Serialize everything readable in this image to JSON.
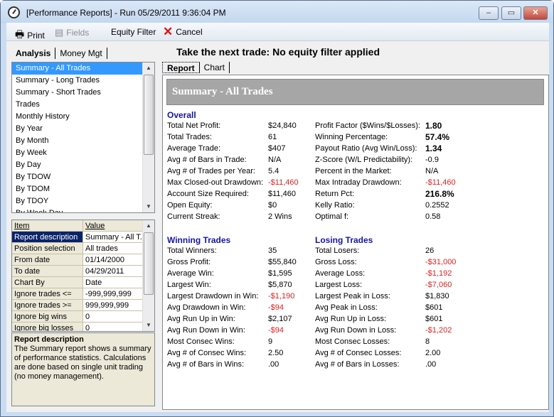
{
  "window": {
    "title": "[Performance Reports]  -  Run 05/29/2011 9:36:04 PM",
    "minimize": "–",
    "maximize": "▭",
    "close": "✕"
  },
  "toolbar": {
    "print": "Print",
    "fields": "Fields",
    "equity_filter": "Equity Filter",
    "cancel": "Cancel"
  },
  "left_tabs": [
    {
      "label": "Analysis"
    },
    {
      "label": "Money Mgt"
    }
  ],
  "reports": [
    "Summary - All Trades",
    "Summary - Long Trades",
    "Summary - Short Trades",
    "Trades",
    "Monthly History",
    "By Year",
    "By Month",
    "By Week",
    "By Day",
    "By TDOW",
    "By TDOM",
    "By TDOY",
    "By Week Day"
  ],
  "properties": {
    "headers": [
      "Item",
      "Value"
    ],
    "rows": [
      [
        "Report description",
        "Summary - All T..."
      ],
      [
        "Position selection",
        "All trades"
      ],
      [
        "From date",
        "01/14/2000"
      ],
      [
        "To date",
        "04/29/2011"
      ],
      [
        "Chart By",
        "Date"
      ],
      [
        "Ignore trades <=",
        "-999,999,999"
      ],
      [
        "Ignore trades >=",
        "999,999,999"
      ],
      [
        "Ignore big wins",
        "0"
      ],
      [
        "Ignore big losses",
        "0"
      ]
    ]
  },
  "description": {
    "title": "Report description",
    "text": "The Summary report shows a summary of performance statistics.  Calculations are done based on single unit trading (no money management)."
  },
  "headline": "Take the next trade: No equity filter applied",
  "right_tabs": [
    {
      "label": "Report"
    },
    {
      "label": "Chart"
    }
  ],
  "report": {
    "title": "Summary - All Trades",
    "overall_title": "Overall",
    "overall_left": [
      [
        "Total Net Profit:",
        "$24,840"
      ],
      [
        "Total Trades:",
        "61"
      ],
      [
        "Average Trade:",
        "$407"
      ],
      [
        "Avg # of Bars in Trade:",
        "N/A"
      ],
      [
        "Avg # of Trades per Year:",
        "5.4"
      ],
      [
        "Max Closed-out Drawdown:",
        "-$11,460"
      ],
      [
        "Account Size Required:",
        "$11,460"
      ],
      [
        "Open Equity:",
        "$0"
      ],
      [
        "Current Streak:",
        "2 Wins"
      ]
    ],
    "overall_right": [
      [
        "Profit Factor ($Wins/$Losses):",
        "1.80"
      ],
      [
        "Winning Percentage:",
        "57.4%"
      ],
      [
        "Payout Ratio (Avg Win/Loss):",
        "1.34"
      ],
      [
        "Z-Score (W/L Predictability):",
        "-0.9"
      ],
      [
        "Percent in the Market:",
        "N/A"
      ],
      [
        "Max Intraday Drawdown:",
        "-$11,460"
      ],
      [
        "Return Pct:",
        "216.8%"
      ],
      [
        "Kelly Ratio:",
        "0.2552"
      ],
      [
        "Optimal f:",
        "0.58"
      ]
    ],
    "winning_title": "Winning Trades",
    "winning": [
      [
        "Total Winners:",
        "35"
      ],
      [
        "Gross Profit:",
        "$55,840"
      ],
      [
        "Average Win:",
        "$1,595"
      ],
      [
        "Largest Win:",
        "$5,870"
      ],
      [
        "Largest Drawdown in Win:",
        "-$1,190"
      ],
      [
        "Avg Drawdown in Win:",
        "-$94"
      ],
      [
        "Avg Run Up in Win:",
        "$2,107"
      ],
      [
        "Avg Run Down in Win:",
        "-$94"
      ],
      [
        "Most Consec Wins:",
        "9"
      ],
      [
        "Avg # of Consec Wins:",
        "2.50"
      ],
      [
        "Avg # of Bars in Wins:",
        ".00"
      ]
    ],
    "losing_title": "Losing Trades",
    "losing": [
      [
        "Total Losers:",
        "26"
      ],
      [
        "Gross Loss:",
        "-$31,000"
      ],
      [
        "Average Loss:",
        "-$1,192"
      ],
      [
        "Largest Loss:",
        "-$7,060"
      ],
      [
        "Largest Peak in Loss:",
        "$1,830"
      ],
      [
        "Avg Peak in Loss:",
        "$601"
      ],
      [
        "Avg Run Up in Loss:",
        "$601"
      ],
      [
        "Avg Run Down in Loss:",
        "-$1,202"
      ],
      [
        "Most Consec Losses:",
        "8"
      ],
      [
        "Avg # of Consec Losses:",
        "2.00"
      ],
      [
        "Avg # of Bars in Losses:",
        ".00"
      ]
    ]
  },
  "colors": {
    "negative": "#e02020",
    "section": "#1515a8",
    "selection": "#3399ff"
  }
}
